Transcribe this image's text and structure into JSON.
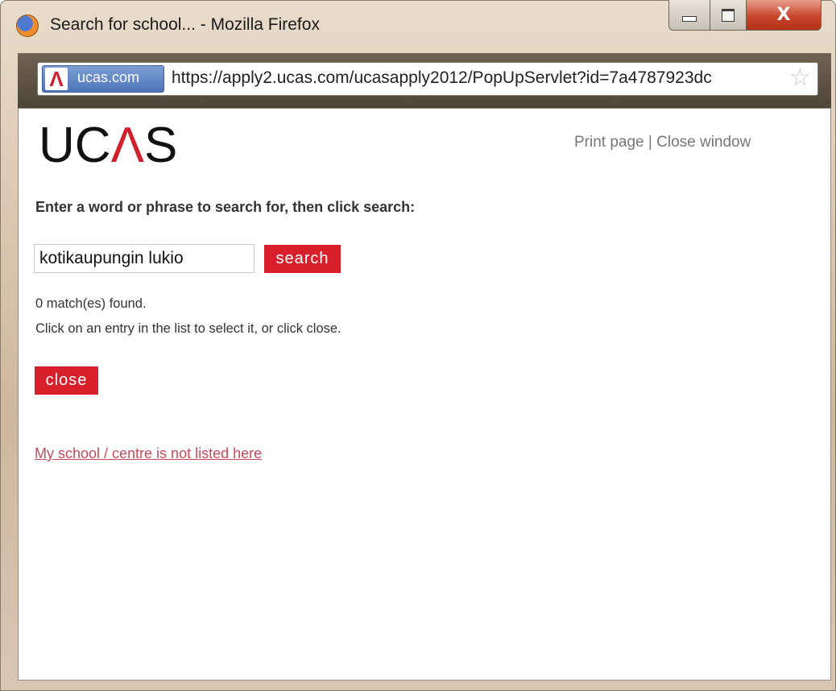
{
  "window": {
    "title": "Search for school... - Mozilla Firefox",
    "close_glyph": "X"
  },
  "urlbar": {
    "site_identity": "ucas.com",
    "site_logo_glyph": "Λ",
    "url": "https://apply2.ucas.com/ucasapply2012/PopUpServlet?id=7a4787923dc",
    "bookmark_icon": "star-icon"
  },
  "page": {
    "logo_left": "UC",
    "logo_mid": "Λ",
    "logo_right": "S",
    "print_link": "Print page",
    "separator": " | ",
    "close_window_link": "Close window",
    "prompt": "Enter a word or phrase to search for, then click search:",
    "search_value": "kotikaupungin lukio",
    "search_button": "search",
    "match_count": "0 match(es) found.",
    "instructions": "Click on an entry in the list to select it, or click close.",
    "close_button": "close",
    "not_listed_link": "My school / centre is not listed here"
  },
  "colors": {
    "brand_red": "#d7202b",
    "link_red": "#c84a5a"
  }
}
